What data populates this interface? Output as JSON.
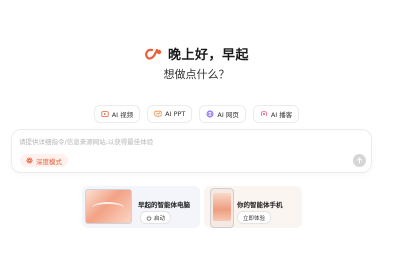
{
  "hero": {
    "greeting": "晚上好，早起",
    "subtitle": "想做点什么？"
  },
  "chips": [
    {
      "label": "AI 视频",
      "icon": "video-icon",
      "color": "#e8603c"
    },
    {
      "label": "AI PPT",
      "icon": "ppt-icon",
      "color": "#f08a3c"
    },
    {
      "label": "AI 网页",
      "icon": "web-icon",
      "color": "#7a5cf0"
    },
    {
      "label": "AI 播客",
      "icon": "podcast-icon",
      "color": "#e85c8a"
    }
  ],
  "input": {
    "placeholder": "请提供详细指令/信息来源网站,以获得最佳体验",
    "deep_mode_label": "深度模式"
  },
  "cards": {
    "pc": {
      "title": "早起的智能体电脑",
      "button": "启动"
    },
    "phone": {
      "title": "你的智能体手机",
      "button": "立即体验"
    }
  },
  "colors": {
    "accent": "#e8603c",
    "send_disabled": "#d6d6d6"
  }
}
